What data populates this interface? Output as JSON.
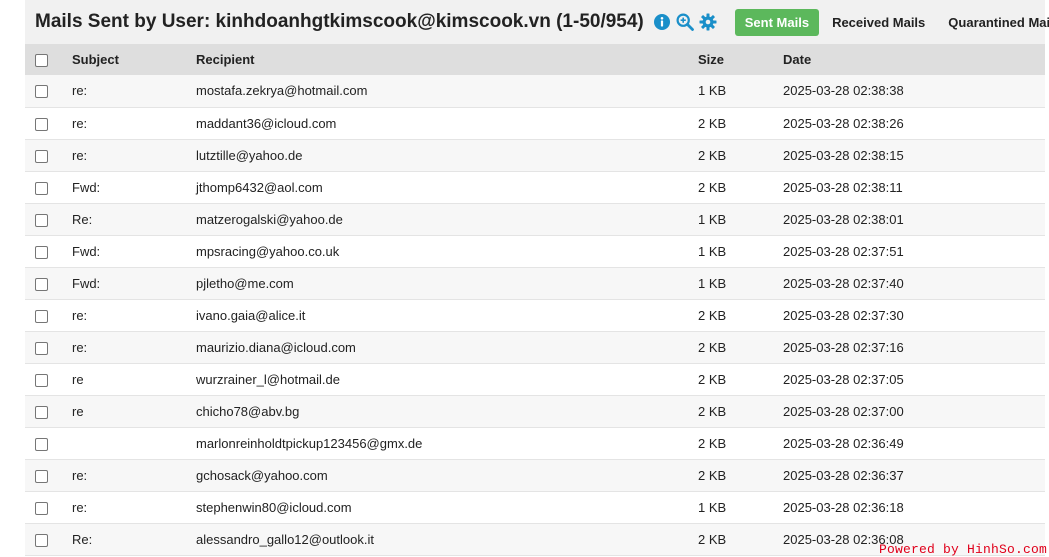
{
  "header": {
    "title": "Mails Sent by User: kinhdoanhgtkimscook@kimscook.vn (1-50/954)",
    "icons": [
      "info-icon",
      "zoom-search-icon",
      "gear-icon"
    ],
    "accent_color": "#1a8fc9",
    "tabs": [
      {
        "label": "Sent Mails",
        "active": true
      },
      {
        "label": "Received Mails",
        "active": false
      },
      {
        "label": "Quarantined Mails",
        "active": false
      }
    ],
    "active_tab_color": "#5cb85c"
  },
  "table": {
    "columns": [
      "Subject",
      "Recipient",
      "Size",
      "Date"
    ],
    "rows": [
      {
        "subject": "re:",
        "recipient": "mostafa.zekrya@hotmail.com",
        "size": "1 KB",
        "date": "2025-03-28 02:38:38"
      },
      {
        "subject": "re:",
        "recipient": "maddant36@icloud.com",
        "size": "2 KB",
        "date": "2025-03-28 02:38:26"
      },
      {
        "subject": "re:",
        "recipient": "lutztille@yahoo.de",
        "size": "2 KB",
        "date": "2025-03-28 02:38:15"
      },
      {
        "subject": "Fwd:",
        "recipient": "jthomp6432@aol.com",
        "size": "2 KB",
        "date": "2025-03-28 02:38:11"
      },
      {
        "subject": "Re:",
        "recipient": "matzerogalski@yahoo.de",
        "size": "1 KB",
        "date": "2025-03-28 02:38:01"
      },
      {
        "subject": "Fwd:",
        "recipient": "mpsracing@yahoo.co.uk",
        "size": "1 KB",
        "date": "2025-03-28 02:37:51"
      },
      {
        "subject": "Fwd:",
        "recipient": "pjletho@me.com",
        "size": "1 KB",
        "date": "2025-03-28 02:37:40"
      },
      {
        "subject": "re:",
        "recipient": "ivano.gaia@alice.it",
        "size": "2 KB",
        "date": "2025-03-28 02:37:30"
      },
      {
        "subject": "re:",
        "recipient": "maurizio.diana@icloud.com",
        "size": "2 KB",
        "date": "2025-03-28 02:37:16"
      },
      {
        "subject": "re",
        "recipient": "wurzrainer_l@hotmail.de",
        "size": "2 KB",
        "date": "2025-03-28 02:37:05"
      },
      {
        "subject": "re",
        "recipient": "chicho78@abv.bg",
        "size": "2 KB",
        "date": "2025-03-28 02:37:00"
      },
      {
        "subject": "",
        "recipient": "marlonreinholdtpickup123456@gmx.de",
        "size": "2 KB",
        "date": "2025-03-28 02:36:49"
      },
      {
        "subject": "re:",
        "recipient": "gchosack@yahoo.com",
        "size": "2 KB",
        "date": "2025-03-28 02:36:37"
      },
      {
        "subject": "re:",
        "recipient": "stephenwin80@icloud.com",
        "size": "1 KB",
        "date": "2025-03-28 02:36:18"
      },
      {
        "subject": "Re:",
        "recipient": "alessandro_gallo12@outlook.it",
        "size": "2 KB",
        "date": "2025-03-28 02:36:08"
      }
    ]
  },
  "watermark": "Powered by HinhSo.com"
}
